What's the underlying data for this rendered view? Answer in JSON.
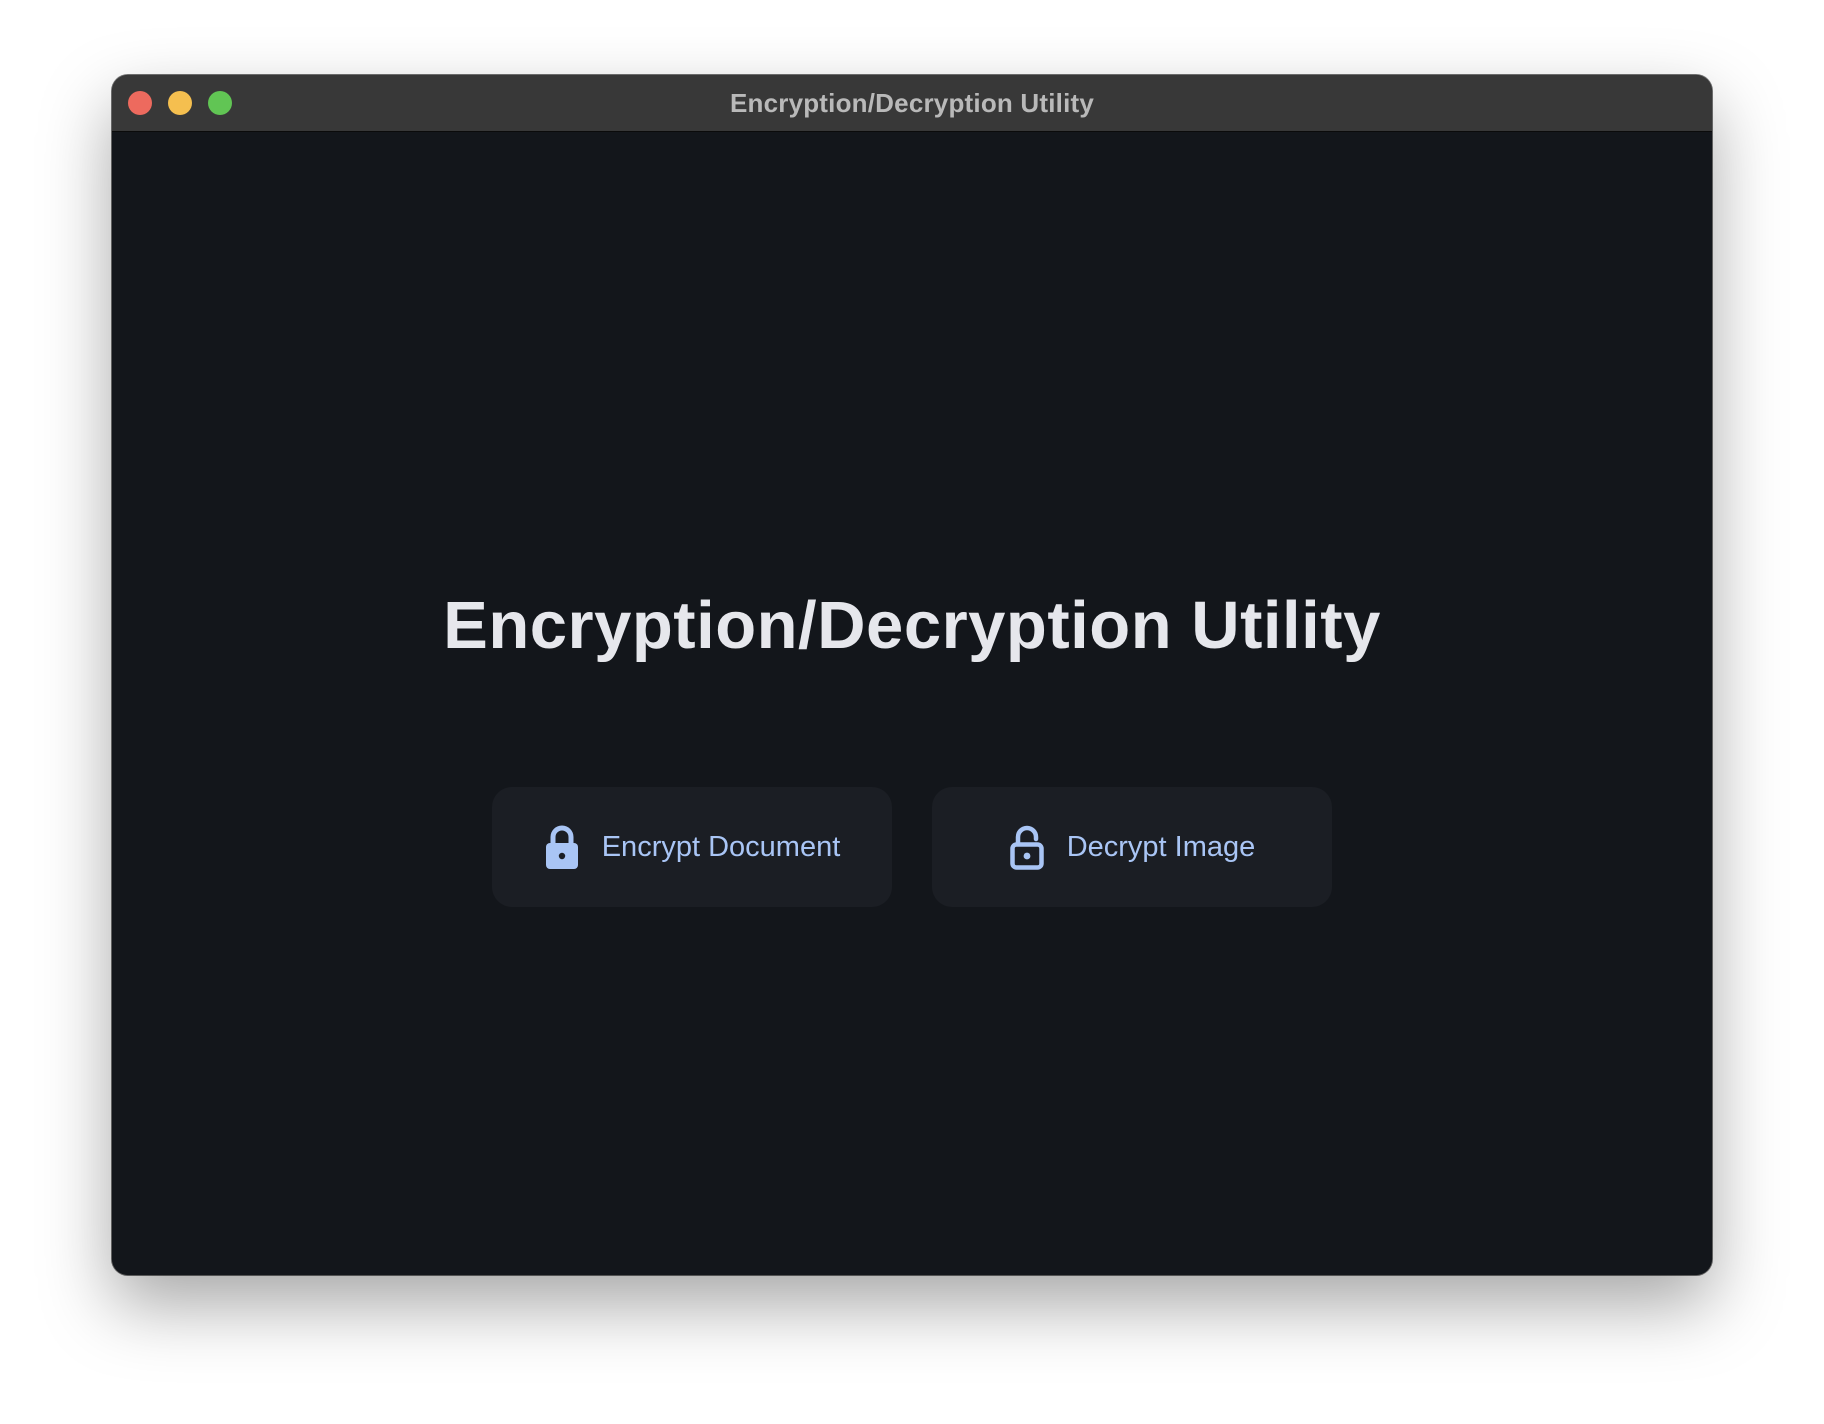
{
  "window": {
    "title": "Encryption/Decryption Utility"
  },
  "main": {
    "heading": "Encryption/Decryption Utility",
    "buttons": [
      {
        "label": "Encrypt Document",
        "icon": "lock-closed-icon"
      },
      {
        "label": "Decrypt Image",
        "icon": "lock-open-icon"
      }
    ]
  },
  "colors": {
    "background": "#13161b",
    "button_bg": "#1b1e24",
    "accent": "#a9c5f5",
    "heading": "#e6e7ec",
    "titlebar": "#383838"
  }
}
